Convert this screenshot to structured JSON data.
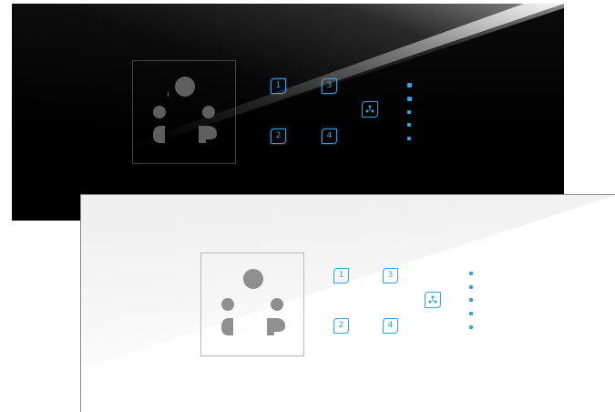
{
  "variants": [
    {
      "name": "black",
      "keys": [
        {
          "label": "1"
        },
        {
          "label": "2"
        },
        {
          "label": "3"
        },
        {
          "label": "4"
        }
      ],
      "fan_icon": "fan-icon",
      "speed_levels": 5
    },
    {
      "name": "white",
      "keys": [
        {
          "label": "1"
        },
        {
          "label": "2"
        },
        {
          "label": "3"
        },
        {
          "label": "4"
        }
      ],
      "fan_icon": "fan-icon",
      "speed_levels": 5
    }
  ],
  "colors": {
    "accent": "#2aa5e6",
    "black_panel": "#000000",
    "white_panel": "#ffffff",
    "socket_dark": "#5f5f5f",
    "socket_light": "#8f8f8f"
  }
}
